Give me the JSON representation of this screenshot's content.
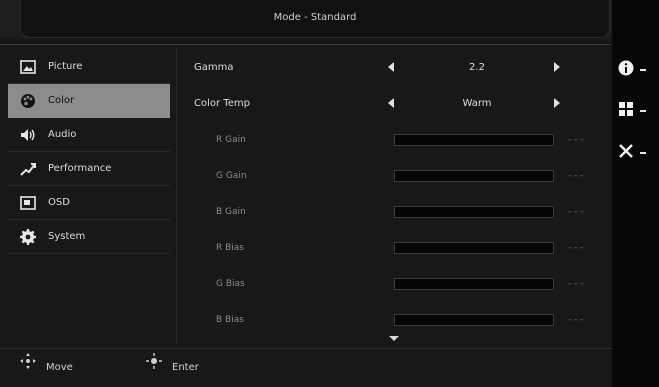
{
  "title": "Mode - Standard",
  "sidebar": {
    "items": [
      {
        "label": "Picture",
        "icon": "picture-icon",
        "active": false
      },
      {
        "label": "Color",
        "icon": "color-palette-icon",
        "active": true
      },
      {
        "label": "Audio",
        "icon": "speaker-icon",
        "active": false
      },
      {
        "label": "Performance",
        "icon": "performance-icon",
        "active": false
      },
      {
        "label": "OSD",
        "icon": "osd-icon",
        "active": false
      },
      {
        "label": "System",
        "icon": "gear-icon",
        "active": false
      }
    ]
  },
  "settings": {
    "gamma": {
      "label": "Gamma",
      "value": "2.2"
    },
    "color_temp": {
      "label": "Color Temp",
      "value": "Warm"
    }
  },
  "sliders": [
    {
      "label": "R Gain"
    },
    {
      "label": "G Gain"
    },
    {
      "label": "B Gain"
    },
    {
      "label": "R Bias"
    },
    {
      "label": "G Bias"
    },
    {
      "label": "B Bias"
    }
  ],
  "footer": {
    "move_label": "Move",
    "enter_label": "Enter"
  },
  "hotkeys": [
    {
      "icon": "info-icon"
    },
    {
      "icon": "menu-grid-icon"
    },
    {
      "icon": "close-icon"
    }
  ],
  "colors": {
    "active_item": "#8c8c8c",
    "panel": "#181818"
  }
}
